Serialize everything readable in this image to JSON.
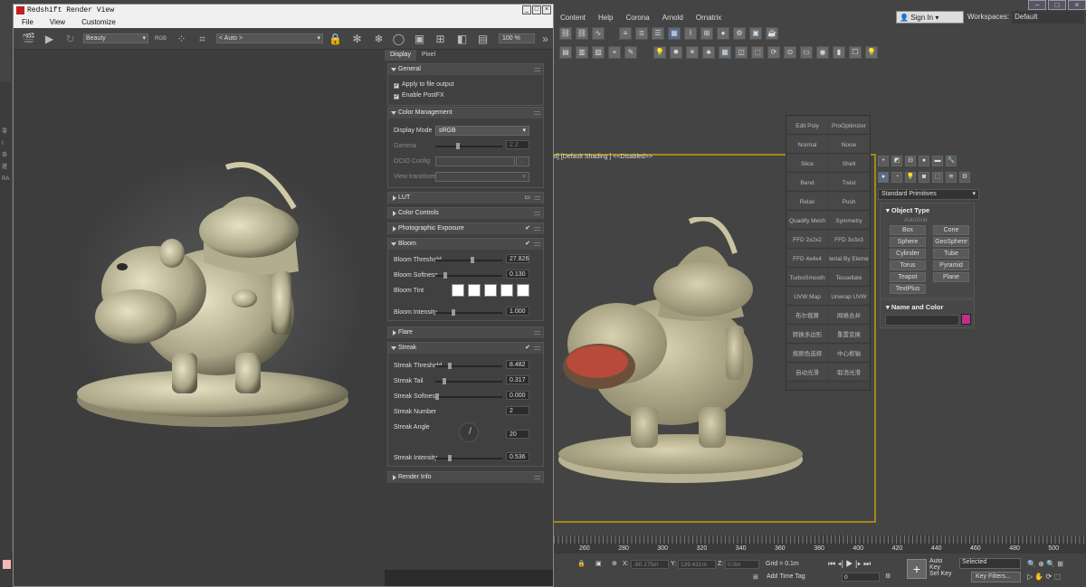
{
  "max": {
    "menu": [
      "Content",
      "Help",
      "Corona",
      "Arnold",
      "Ornatrix"
    ],
    "sign_in": "Sign In",
    "workspaces_label": "Workspaces:",
    "workspaces_value": "Default",
    "viewport_label": "d] [Default Shading ]  <<Disabled>>",
    "modifiers": [
      [
        "Edit Poly",
        "ProOptimizer"
      ],
      [
        "Normal",
        "Noise"
      ],
      [
        "Slice",
        "Shell"
      ],
      [
        "Bend",
        "Twist"
      ],
      [
        "Relax",
        "Push"
      ],
      [
        "Quadify Mesh",
        "Symmetry"
      ],
      [
        "FFD 2x2x2",
        "FFD 3x3x3"
      ],
      [
        "FFD 4x4x4",
        "terial By Eleme"
      ],
      [
        "TurboSmooth",
        "Tessellate"
      ],
      [
        "UVW Map",
        "Unwrap UVW"
      ],
      [
        "布尔裁算",
        "网格合并"
      ],
      [
        "转换多边形",
        "重置变换"
      ],
      [
        "按颜色选择",
        "中心枢轴"
      ],
      [
        "自动光滑",
        "取消光滑"
      ]
    ],
    "standard_primitives": "Standard Primitives",
    "object_type_title": "Object Type",
    "autogrid": "AutoGrid",
    "primitives": [
      "Box",
      "Cone",
      "Sphere",
      "GeoSphere",
      "Cylinder",
      "Tube",
      "Torus",
      "Pyramid",
      "Teapot",
      "Plane",
      "TextPlus"
    ],
    "name_color_title": "Name and Color",
    "name_color_swatch": "#c0308a",
    "ruler": [
      "260",
      "280",
      "300",
      "320",
      "340",
      "360",
      "380",
      "400",
      "420",
      "440",
      "460",
      "480",
      "500"
    ],
    "status": {
      "x_label": "X:",
      "x_value": "-80.175m",
      "y_label": "Y:",
      "y_value": "139.431m",
      "z_label": "Z:",
      "z_value": "0.0m",
      "grid": "Grid = 0.1m",
      "add_time_tag": "Add Time Tag",
      "auto_key": "Auto Key",
      "set_key": "Set Key",
      "selected": "Selected",
      "key_filters": "Key Filters...",
      "frame": "0"
    },
    "left_labels": [
      "零",
      "Ⅰ",
      "各",
      "搓",
      "RA"
    ]
  },
  "redshift": {
    "title": "Redshift Render View",
    "menu": [
      "File",
      "View",
      "Customize"
    ],
    "aov": "Beauty",
    "camera": "< Auto >",
    "zoom": "100 %",
    "tabs": [
      "Display",
      "Pixel"
    ],
    "sections": {
      "general": "General",
      "apply_file_output": "Apply to file output",
      "enable_postfx": "Enable PostFX",
      "color_management": "Color Management",
      "display_mode_label": "Display Mode",
      "display_mode_value": "sRGB",
      "gamma_label": "Gamma",
      "gamma_value": "2.2",
      "ocio_label": "OCIO Config",
      "view_transform_label": "View transform",
      "lut": "LUT",
      "color_controls": "Color Controls",
      "photographic_exposure": "Photographic Exposure",
      "bloom": "Bloom",
      "bloom_threshold_label": "Bloom Threshold",
      "bloom_threshold": "27.826",
      "bloom_softness_label": "Bloom Softness",
      "bloom_softness": "0.130",
      "bloom_tint_label": "Bloom Tint",
      "bloom_intensity_label": "Bloom Intensity",
      "bloom_intensity": "1.000",
      "flare": "Flare",
      "streak": "Streak",
      "streak_threshold_label": "Streak Threshold",
      "streak_threshold": "8.482",
      "streak_tail_label": "Streak Tail",
      "streak_tail": "0.317",
      "streak_softness_label": "Streak Softness",
      "streak_softness": "0.000",
      "streak_number_label": "Streak Number",
      "streak_number": "2",
      "streak_angle_label": "Streak Angle",
      "streak_angle": "20",
      "streak_intensity_label": "Streak Intensity",
      "streak_intensity": "0.536",
      "render_info": "Render Info"
    },
    "sliders": {
      "gamma": 0.33,
      "bloom_threshold": 0.55,
      "bloom_softness": 0.13,
      "bloom_intensity": 0.25,
      "streak_threshold": 0.2,
      "streak_tail": 0.12,
      "streak_softness": 0.0,
      "streak_intensity": 0.2
    }
  }
}
